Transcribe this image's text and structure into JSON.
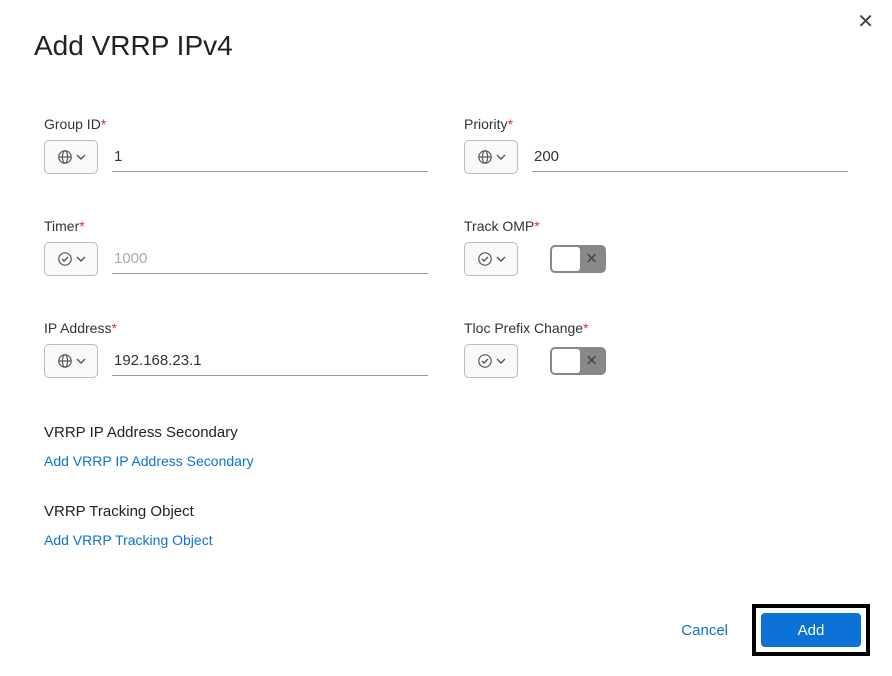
{
  "title": "Add VRRP IPv4",
  "fields": {
    "group_id": {
      "label": "Group ID",
      "value": "1",
      "type": "globe"
    },
    "priority": {
      "label": "Priority",
      "value": "200",
      "type": "globe"
    },
    "timer": {
      "label": "Timer",
      "placeholder": "1000",
      "type": "check"
    },
    "track_omp": {
      "label": "Track OMP",
      "type": "check",
      "toggle": false
    },
    "ip_address": {
      "label": "IP Address",
      "value": "192.168.23.1",
      "type": "globe"
    },
    "tloc_prefix": {
      "label": "Tloc Prefix Change",
      "type": "check",
      "toggle": false
    }
  },
  "sections": {
    "secondary": {
      "title": "VRRP IP Address Secondary",
      "link": "Add VRRP IP Address Secondary"
    },
    "tracking": {
      "title": "VRRP Tracking Object",
      "link": "Add VRRP Tracking Object"
    }
  },
  "buttons": {
    "cancel": "Cancel",
    "add": "Add"
  }
}
